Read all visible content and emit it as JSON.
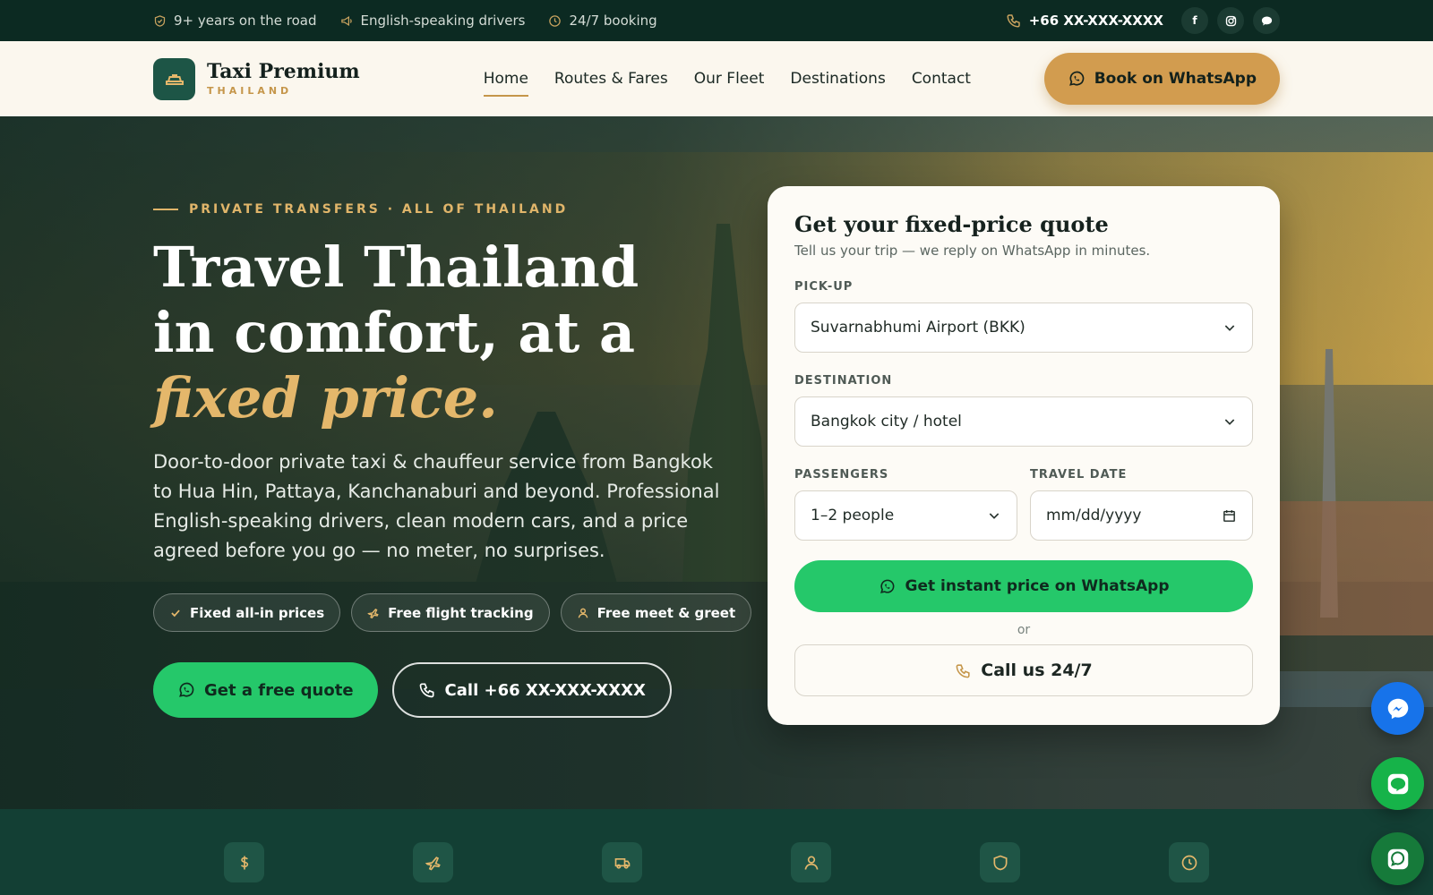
{
  "topbar": {
    "items": [
      {
        "icon": "shield-check-icon",
        "label": "9+ years on the road"
      },
      {
        "icon": "megaphone-icon",
        "label": "English-speaking drivers"
      },
      {
        "icon": "clock-icon",
        "label": "24/7 booking"
      }
    ],
    "phone": "+66 XX-XXX-XXXX",
    "socials": [
      "facebook-icon",
      "instagram-icon",
      "chat-bubble-icon"
    ],
    "facebook_letter": "f"
  },
  "brand": {
    "name": "Taxi Premium",
    "sub": "THAILAND",
    "accent_color": "#c5964a",
    "primary_green": "#1d5546"
  },
  "nav": {
    "items": [
      "Home",
      "Routes & Fares",
      "Our Fleet",
      "Destinations",
      "Contact"
    ],
    "active": "Home"
  },
  "header_cta": {
    "label": "Book on WhatsApp",
    "color": "#d29c4f"
  },
  "hero": {
    "eyebrow": "PRIVATE TRANSFERS · ALL OF THAILAND",
    "headline_part1": "Travel Thailand in comfort, at a ",
    "headline_accent": "fixed price.",
    "lead": "Door-to-door private taxi & chauffeur service from Bangkok to Hua Hin, Pattaya, Kanchanaburi and beyond. Professional English-speaking drivers, clean modern cars, and a price agreed before you go — no meter, no surprises.",
    "chips": [
      {
        "icon": "check-icon",
        "label": "Fixed all-in prices"
      },
      {
        "icon": "plane-icon",
        "label": "Free flight tracking"
      },
      {
        "icon": "person-icon",
        "label": "Free meet & greet"
      }
    ],
    "cta_primary": "Get a free quote",
    "cta_secondary": "Call +66 XX-XXX-XXXX",
    "whatsapp_green": "#25c86a"
  },
  "quote_card": {
    "title": "Get your fixed-price quote",
    "subtitle": "Tell us your trip — we reply on WhatsApp in minutes.",
    "pickup_label": "PICK-UP",
    "pickup_value": "Suvarnabhumi Airport (BKK)",
    "destination_label": "DESTINATION",
    "destination_value": "Bangkok city / hotel",
    "passengers_label": "PASSENGERS",
    "passengers_value": "1–2 people",
    "date_label": "TRAVEL DATE",
    "date_placeholder": "mm/dd/yyyy",
    "whatsapp_button": "Get instant price on WhatsApp",
    "or_text": "or",
    "call_button": "Call us 24/7"
  },
  "floating": [
    "messenger-icon",
    "line-icon",
    "whatsapp-icon"
  ],
  "features": [
    "dollar-icon",
    "plane-icon",
    "van-icon",
    "person-icon",
    "shield-icon",
    "clock-icon"
  ]
}
